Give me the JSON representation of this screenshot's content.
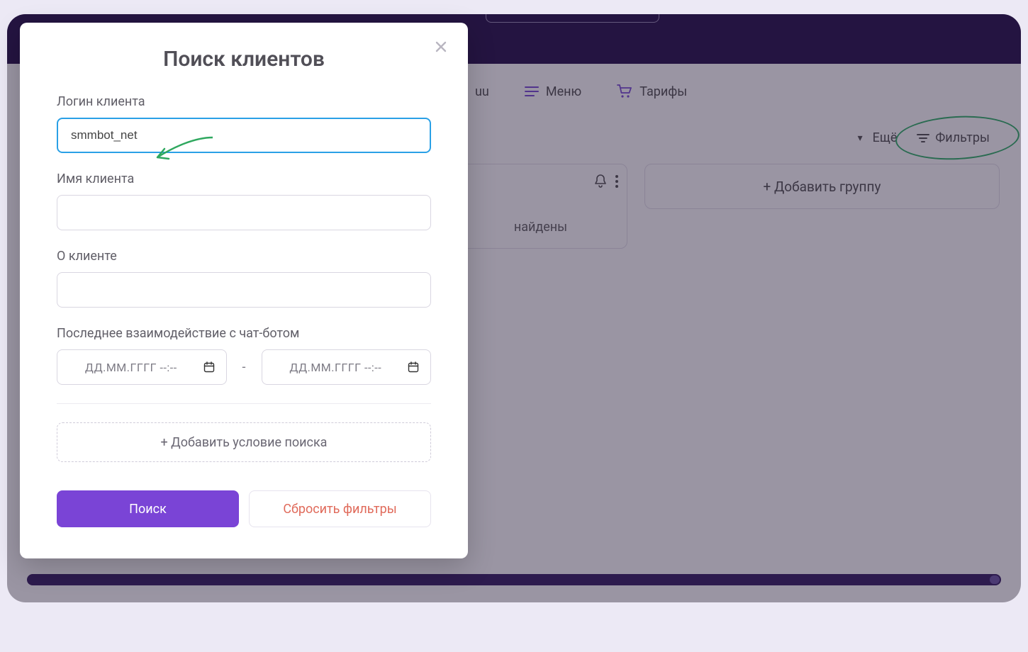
{
  "nav": {
    "fragment": "uu",
    "menu_label": "Меню",
    "tariffs_label": "Тарифы"
  },
  "toolbar": {
    "more_label": "Ещё",
    "filters_label": "Фильтры"
  },
  "panel": {
    "found_fragment": "найдены"
  },
  "add_group_label": "+ Добавить группу",
  "modal": {
    "title": "Поиск клиентов",
    "login_label": "Логин клиента",
    "login_value": "smmbot_net",
    "name_label": "Имя клиента",
    "name_value": "",
    "about_label": "О клиенте",
    "about_value": "",
    "lastint_label": "Последнее взаимодействие с чат-ботом",
    "date_placeholder": "ДД.ММ.ГГГГ --:--",
    "date_separator": "-",
    "add_condition_label": "+ Добавить условие поиска",
    "search_btn": "Поиск",
    "reset_btn": "Сбросить фильтры"
  },
  "colors": {
    "accent": "#7a44d6",
    "annotation": "#34b36a",
    "danger": "#e06a5a"
  }
}
